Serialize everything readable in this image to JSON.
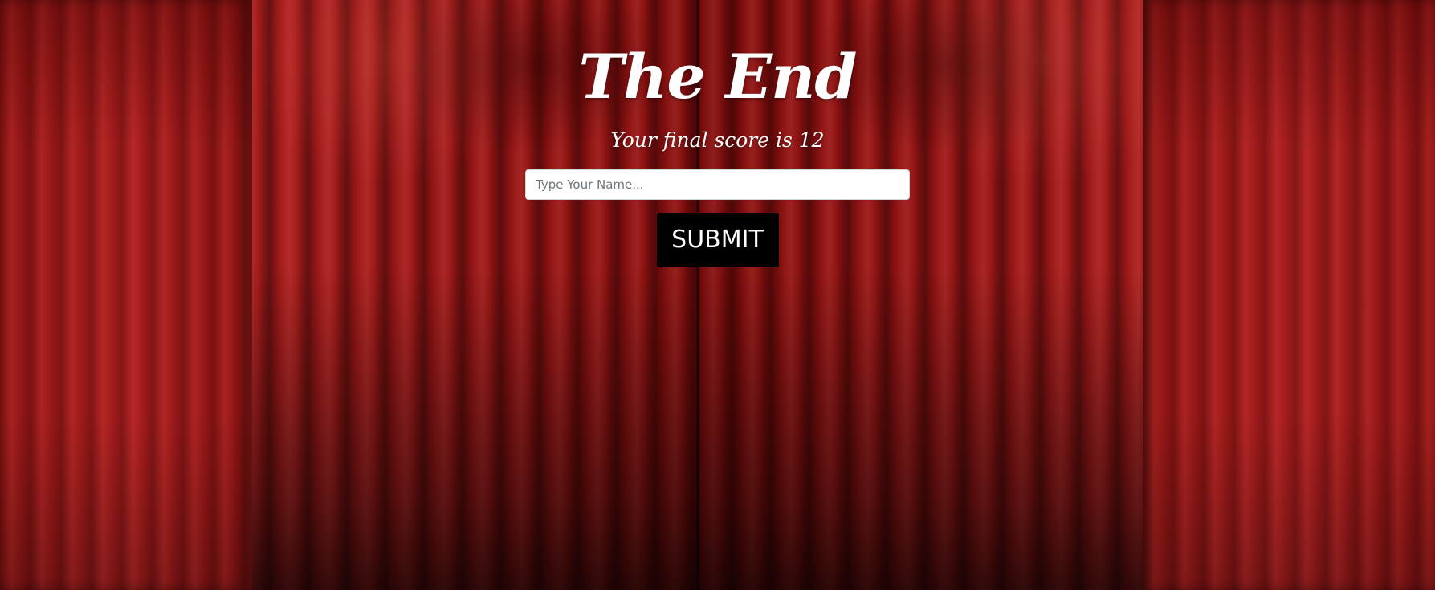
{
  "end_screen": {
    "title": "The End",
    "score_text": "Your final score is 12",
    "name_input": {
      "value": "",
      "placeholder": "Type Your Name..."
    },
    "submit_label": "SUBMIT"
  },
  "colors": {
    "curtain": "#8d1111",
    "button_background": "#000000",
    "text": "#ffffff"
  }
}
